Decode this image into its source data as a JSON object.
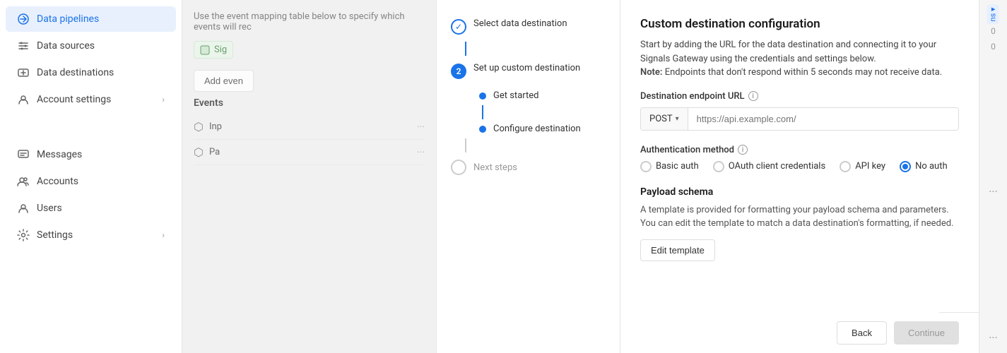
{
  "sidebar": {
    "items": [
      {
        "id": "data-pipelines",
        "label": "Data pipelines",
        "icon": "⬡",
        "active": true
      },
      {
        "id": "data-sources",
        "label": "Data sources",
        "icon": "◈",
        "active": false
      },
      {
        "id": "data-destinations",
        "label": "Data destinations",
        "icon": "◫",
        "active": false
      },
      {
        "id": "account-settings",
        "label": "Account settings",
        "icon": "⚙",
        "active": false,
        "hasChevron": true
      },
      {
        "id": "messages",
        "label": "Messages",
        "icon": "✉",
        "active": false
      },
      {
        "id": "accounts",
        "label": "Accounts",
        "icon": "👤",
        "active": false
      },
      {
        "id": "users",
        "label": "Users",
        "icon": "👥",
        "active": false
      },
      {
        "id": "settings",
        "label": "Settings",
        "icon": "⚙",
        "active": false,
        "hasChevron": true
      }
    ]
  },
  "middle": {
    "description": "Use the event mapping table below to specify which events will rec",
    "signal_label": "Sig",
    "add_event_label": "Add even",
    "events_header": "Events",
    "event_rows": [
      {
        "name": "Inp",
        "icon": "⬡"
      },
      {
        "name": "Pa",
        "icon": "⬡"
      }
    ]
  },
  "wizard": {
    "steps": [
      {
        "id": "select-destination",
        "label": "Select data destination",
        "status": "complete"
      },
      {
        "id": "setup-custom",
        "label": "Set up custom destination",
        "status": "active",
        "number": "2",
        "substeps": [
          {
            "id": "get-started",
            "label": "Get started",
            "status": "active"
          },
          {
            "id": "configure-destination",
            "label": "Configure destination",
            "status": "active"
          }
        ]
      },
      {
        "id": "next-steps",
        "label": "Next steps",
        "status": "inactive"
      }
    ]
  },
  "config": {
    "title": "Custom destination configuration",
    "description": "Start by adding the URL for the data destination and connecting it to your Signals Gateway using the credentials and settings below.",
    "note_label": "Note:",
    "note_text": " Endpoints that don't respond within 5 seconds may not receive data.",
    "endpoint": {
      "label": "Destination endpoint URL",
      "method": "POST",
      "placeholder": "https://api.example.com/"
    },
    "auth": {
      "label": "Authentication method",
      "options": [
        {
          "id": "basic",
          "label": "Basic auth",
          "selected": false
        },
        {
          "id": "oauth",
          "label": "OAuth client credentials",
          "selected": false
        },
        {
          "id": "api-key",
          "label": "API key",
          "selected": false
        },
        {
          "id": "no-auth",
          "label": "No auth",
          "selected": true
        }
      ]
    },
    "payload": {
      "title": "Payload schema",
      "description": "A template is provided for formatting your payload schema and parameters. You can edit the template to match a data destination's formatting, if needed.",
      "edit_button_label": "Edit template"
    },
    "footer": {
      "back_label": "Back",
      "continue_label": "Continue"
    }
  },
  "right_edge": {
    "badge_text": "ns",
    "count1": "0",
    "count2": "0"
  }
}
